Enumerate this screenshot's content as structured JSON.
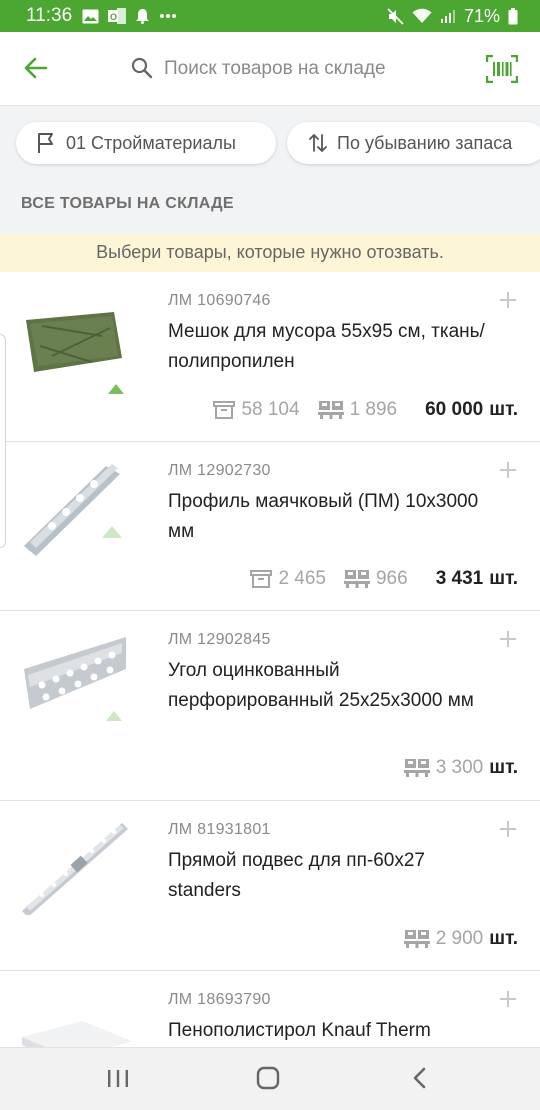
{
  "status": {
    "time": "11:36",
    "battery": "71%"
  },
  "search": {
    "placeholder": "Поиск товаров на складе"
  },
  "filters": {
    "department": "01 Стройматериалы",
    "sort": "По убыванию запаса"
  },
  "section_title": "ВСЕ ТОВАРЫ НА СКЛАДЕ",
  "hint": "Выбери товары, которые нужно отозвать.",
  "colors": {
    "brand_green": "#4ca632",
    "hint_bg": "#fdf6d6"
  },
  "products": [
    {
      "code": "ЛМ 10690746",
      "name": "Мешок для мусора 55x95 см, ткань/полипропилен",
      "stock_store": "58 104",
      "stock_warehouse": "1 896",
      "quantity": "60 000",
      "unit": "шт."
    },
    {
      "code": "ЛМ 12902730",
      "name": "Профиль маячковый (ПМ) 10х3000 мм",
      "stock_store": "2 465",
      "stock_warehouse": "966",
      "quantity": "3 431",
      "unit": "шт."
    },
    {
      "code": "ЛМ 12902845",
      "name": "Угол оцинкованный перфорированный 25х25х3000 мм",
      "stock_warehouse": "3 300",
      "unit": "шт."
    },
    {
      "code": "ЛМ 81931801",
      "name": "Прямой подвес для пп-60х27 standers",
      "stock_warehouse": "2 900",
      "unit": "шт."
    },
    {
      "code": "ЛМ 18693790",
      "name": "Пенополистирол Knauf Therm"
    }
  ]
}
